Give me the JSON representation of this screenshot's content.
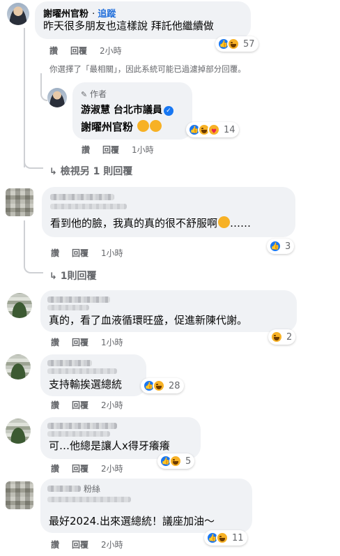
{
  "comments": [
    {
      "name": "謝曜州官粉",
      "follow": "追蹤",
      "text": "昨天很多朋友也這樣說 拜託他繼續做",
      "actions": {
        "like": "讚",
        "reply": "回覆",
        "time": "2小時"
      },
      "reactions": {
        "icons": [
          "like-icon",
          "haha-icon"
        ],
        "count": "57"
      }
    },
    {
      "role": "作者",
      "name": "游淑慧 台北市議員",
      "text": "謝曜州官粉",
      "emoji": [
        "rolling-laughing-icon",
        "rolling-laughing-icon"
      ],
      "actions": {
        "like": "讚",
        "reply": "回覆",
        "time": "1小時"
      },
      "reactions": {
        "icons": [
          "like-icon",
          "haha-icon",
          "care-icon"
        ],
        "count": "14"
      }
    },
    {
      "text": "看到他的臉，我真的真的很不舒服啊",
      "text_suffix": "……",
      "emoji": [
        "crying-face-icon"
      ],
      "actions": {
        "like": "讚",
        "reply": "回覆",
        "time": "1小時"
      },
      "reactions": {
        "icons": [
          "like-icon"
        ],
        "count": "3"
      }
    },
    {
      "text": "真的，看了血液循環旺盛，促進新陳代謝。",
      "actions": {
        "like": "讚",
        "reply": "回覆",
        "time": "1小時"
      },
      "reactions": {
        "icons": [
          "haha-icon"
        ],
        "count": "2"
      }
    },
    {
      "text": "支持輸挨選總統",
      "actions": {
        "like": "讚",
        "reply": "回覆",
        "time": "2小時"
      },
      "reactions": {
        "icons": [
          "like-icon",
          "haha-icon"
        ],
        "count": "28"
      }
    },
    {
      "text": "可…他總是讓人x得牙癢癢",
      "actions": {
        "like": "讚",
        "reply": "回覆",
        "time": "2小時"
      },
      "reactions": {
        "icons": [
          "like-icon",
          "haha-icon"
        ],
        "count": "5"
      }
    },
    {
      "fans": "粉絲",
      "text": "最好2024.出來選總統！議座加油～",
      "actions": {
        "like": "讚",
        "reply": "回覆",
        "time": "2小時"
      },
      "reactions": {
        "icons": [
          "like-icon",
          "haha-icon"
        ],
        "count": "11"
      }
    }
  ],
  "filter_notice": "你選擇了「最相關」，因此系統可能已過濾掉部分回覆。",
  "view_more_1": "檢視另 1 則回覆",
  "view_more_2": "1則回覆",
  "colors": {
    "link_blue": "#216fdb",
    "like_blue": "#1877f2",
    "haha_yellow": "#f7b125",
    "bubble_bg": "#f0f2f5",
    "meta_grey": "#65676b"
  }
}
